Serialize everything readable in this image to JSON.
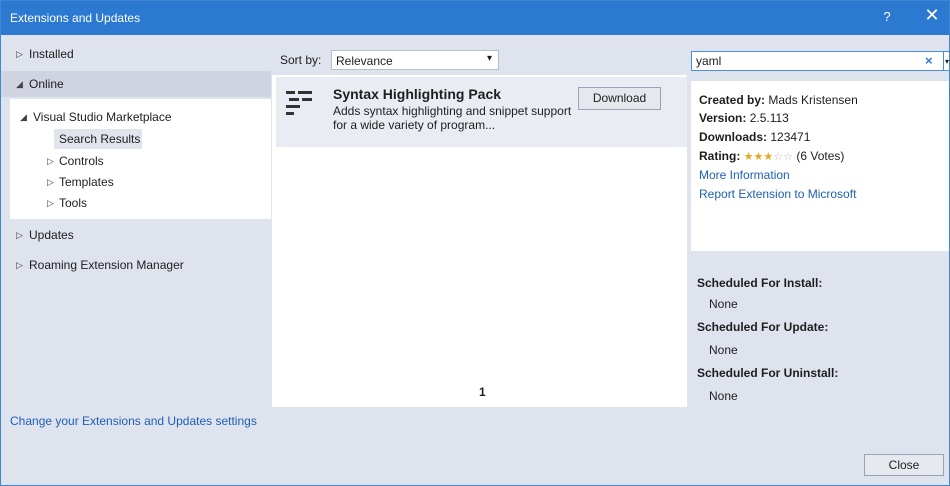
{
  "window": {
    "title": "Extensions and Updates",
    "help_glyph": "?",
    "close_glyph": "✕"
  },
  "nav": {
    "installed": "Installed",
    "online": "Online",
    "marketplace": "Visual Studio Marketplace",
    "search_results": "Search Results",
    "controls": "Controls",
    "templates": "Templates",
    "tools": "Tools",
    "updates": "Updates",
    "roaming": "Roaming Extension Manager"
  },
  "sort": {
    "label": "Sort by:",
    "value": "Relevance"
  },
  "results": [
    {
      "name": "Syntax Highlighting Pack",
      "description": "Adds syntax highlighting and snippet support for a wide variety of program...",
      "action": "Download"
    }
  ],
  "pager": {
    "page": "1"
  },
  "search": {
    "value": "yaml",
    "clear_glyph": "×"
  },
  "details": {
    "created_by_label": "Created by:",
    "created_by": "Mads Kristensen",
    "version_label": "Version:",
    "version": "2.5.113",
    "downloads_label": "Downloads:",
    "downloads": "123471",
    "rating_label": "Rating:",
    "rating_stars": 3.5,
    "rating_votes": "(6 Votes)",
    "more_info": "More Information",
    "report": "Report Extension to Microsoft"
  },
  "scheduled": {
    "install_label": "Scheduled For Install:",
    "install_value": "None",
    "update_label": "Scheduled For Update:",
    "update_value": "None",
    "uninstall_label": "Scheduled For Uninstall:",
    "uninstall_value": "None"
  },
  "footer": {
    "settings_link": "Change your Extensions and Updates settings",
    "close": "Close"
  },
  "colors": {
    "titlebar": "#2b79d0",
    "panel": "#dfe3ee",
    "link": "#1e5fb5",
    "star": "#e6a820"
  }
}
